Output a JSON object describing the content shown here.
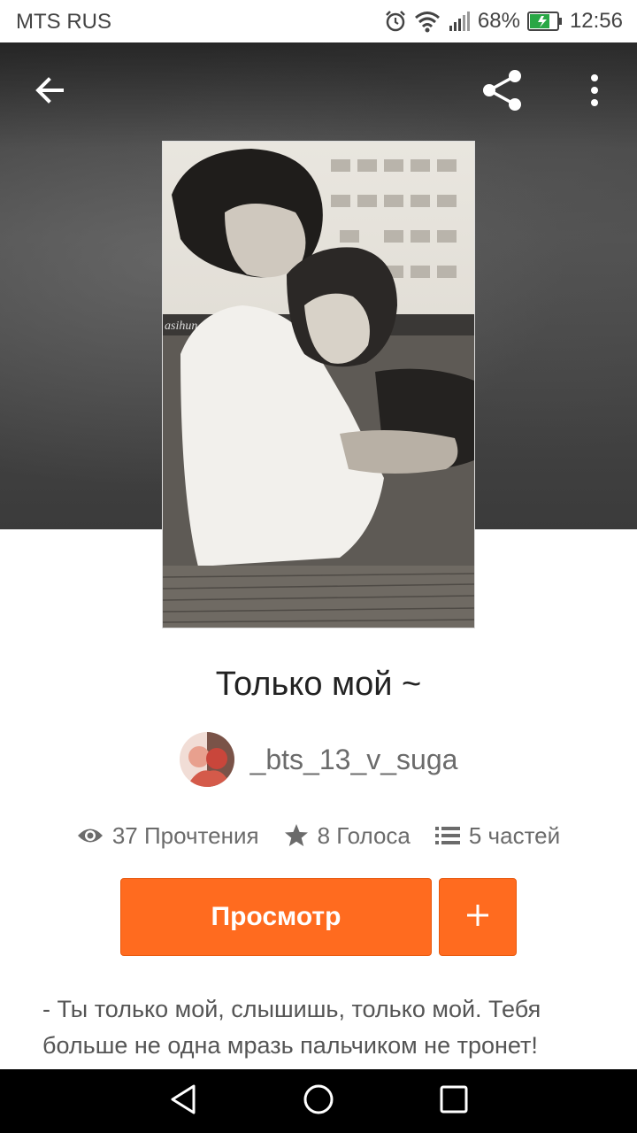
{
  "status_bar": {
    "carrier": "MTS RUS",
    "battery_percent": "68%",
    "time": "12:56",
    "icons": [
      "alarm-icon",
      "wifi-icon",
      "signal-icon",
      "battery-icon"
    ]
  },
  "header": {
    "back_icon": "arrow-left-icon",
    "share_icon": "share-icon",
    "more_icon": "more-vertical-icon"
  },
  "story": {
    "cover_watermark": "asihun",
    "title": "Только мой ~",
    "author": "_bts_13_v_suga",
    "stats": {
      "reads": "37 Прочтения",
      "votes": "8 Голоса",
      "parts": "5 частей"
    },
    "description": "- Ты только мой, слышишь, только мой. Тебя больше не одна мразь пальчиком не тронет!"
  },
  "actions": {
    "view_label": "Просмотр",
    "add_icon": "plus-icon"
  },
  "colors": {
    "accent": "#ff6b1f",
    "text_dark": "#222222",
    "text_muted": "#6b6b6b"
  },
  "nav_bar": {
    "icons": [
      "back-triangle-icon",
      "home-circle-icon",
      "recents-square-icon"
    ]
  }
}
